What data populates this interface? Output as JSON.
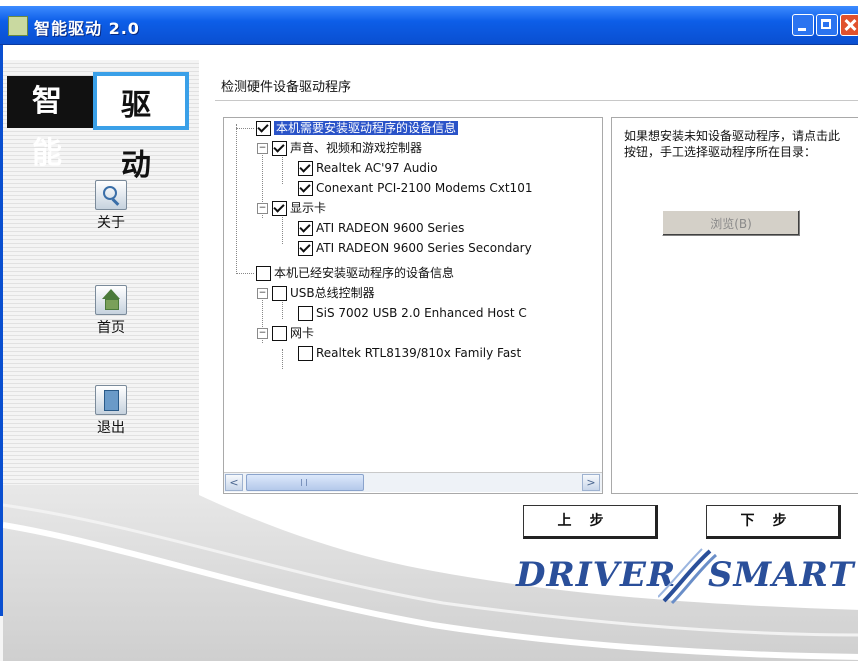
{
  "top_strip_text": "",
  "window": {
    "title": "智能驱动 2.0"
  },
  "logo": {
    "left": "智 能",
    "right": "驱 动"
  },
  "nav": [
    {
      "label": "关于",
      "icon": "magnifier-icon"
    },
    {
      "label": "首页",
      "icon": "home-icon"
    },
    {
      "label": "退出",
      "icon": "exit-icon"
    }
  ],
  "main": {
    "section_title": "检测硬件设备驱动程序",
    "tree": [
      {
        "text": "本机需要安装驱动程序的设备信息",
        "checked": true,
        "selected": true
      },
      {
        "text": "声音、视频和游戏控制器",
        "checked": true
      },
      {
        "text": "Realtek AC'97 Audio",
        "checked": true
      },
      {
        "text": "Conexant PCI-2100 Modems Cxt101",
        "checked": true
      },
      {
        "text": "显示卡",
        "checked": true
      },
      {
        "text": "ATI RADEON 9600 Series",
        "checked": true
      },
      {
        "text": "ATI RADEON 9600 Series Secondary",
        "checked": true
      },
      {
        "text": "本机已经安装驱动程序的设备信息",
        "checked": false
      },
      {
        "text": "USB总线控制器",
        "checked": false
      },
      {
        "text": "SiS 7002 USB 2.0 Enhanced Host C",
        "checked": false
      },
      {
        "text": "网卡",
        "checked": false
      },
      {
        "text": "Realtek RTL8139/810x Family Fast",
        "checked": false
      }
    ],
    "info_text": "如果想安装未知设备驱动程序，请点击此按钮，手工选择驱动程序所在目录：",
    "select_button": "浏览(B)"
  },
  "footer": {
    "prev_label": "上步",
    "next_label": "下步",
    "brand_left": "DRIVER",
    "brand_right": "SMART"
  },
  "colors": {
    "titlebar": "#0d5ee8",
    "accent": "#3aa0e8",
    "brand": "#2a4f9a",
    "selection": "#2a53c8"
  }
}
